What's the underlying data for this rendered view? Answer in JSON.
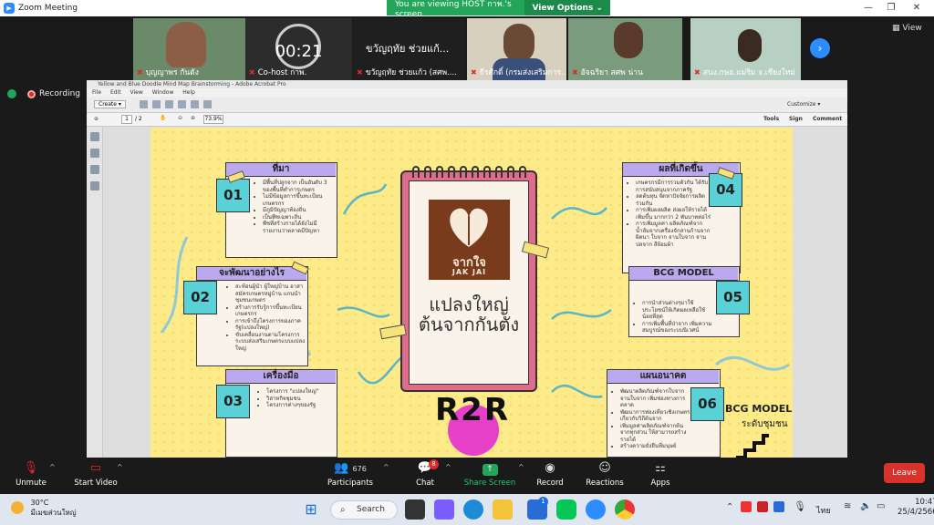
{
  "zoom": {
    "window_title": "Zoom Meeting",
    "banner_text": "You are viewing HOST กาพ.'s screen",
    "view_options_label": "View Options",
    "view_label": "View",
    "recording_label": "Recording",
    "timer": "00:21",
    "participants": [
      {
        "name": "บุญญาพร กันดัง"
      },
      {
        "name": "Co-host กาพ."
      },
      {
        "name": "ขวัญฤทัย ช่วยแก้ว (สศพ...."
      },
      {
        "name": "ธีรศักดิ์ (กรมส่งเสริมการ..."
      },
      {
        "name": "อัจฉริยา สศพ น่าน"
      },
      {
        "name": "สนง.กษอ.แม่ริม จ.เชียงใหม่"
      }
    ],
    "speaker_caption": "ขวัญฤทัย ช่วยแก้...",
    "toolbar": {
      "unmute": "Unmute",
      "start_video": "Start Video",
      "participants": "Participants",
      "participants_count": "676",
      "chat": "Chat",
      "chat_badge": "8",
      "share_screen": "Share Screen",
      "record": "Record",
      "reactions": "Reactions",
      "apps": "Apps",
      "leave": "Leave"
    }
  },
  "acrobat": {
    "title": "Yellow and Blue Doodle Mind Map Brainstorming - Adobe Acrobat Pro",
    "menu": [
      "File",
      "Edit",
      "View",
      "Window",
      "Help"
    ],
    "create_label": "Create",
    "page_num": "1",
    "page_total": "/ 2",
    "zoom": "73.9%",
    "customize": "Customize",
    "tools": "Tools",
    "sign": "Sign",
    "comment": "Comment"
  },
  "mindmap": {
    "center": {
      "brand": "จากใจ",
      "brand_en": "JAK JAI",
      "slogan_line1": "แปลงใหญ่",
      "slogan_line2": "ต้นจากกันตัง"
    },
    "cards": [
      {
        "num": "01",
        "title": "ที่มา",
        "items": [
          "มีพื้นที่ปลูกจาก เป็นอันดับ 3 ของพื้นที่ทำการเกษตร",
          "ไม่มีข้อมูลการขึ้นทะเบียนเกษตรกร",
          "มีภูมิปัญญาท้องถิ่น",
          "เป็นพืชเฉพาะถิ่น",
          "พืชที่สร้างรายได้ยังไม่มีรายงานว่าตลาดมีปัญหา"
        ]
      },
      {
        "num": "02",
        "title": "จะพัฒนาอย่างไร",
        "items": [
          "สะท้อนผู้นำ ผู้ใหญ่บ้าน อาสาสมัครเกษตรหมู่บ้าน แกนนำชุมชนเกษตร",
          "สร้างการรับรู้การขึ้นทะเบียนเกษตรกร",
          "การเข้าถึงโครงการของภาครัฐ(แปลงใหญ่)",
          "ขับเคลื่อนงานตามโครงการระบบส่งเสริมเกษตรแบบแปลงใหญ่"
        ]
      },
      {
        "num": "03",
        "title": "เครื่องมือ",
        "items": [
          "โครงการ \"แปลงใหญ่\"",
          "วิสาหกิจชุมชน",
          "โครงการต่างๆของรัฐ"
        ]
      },
      {
        "num": "04",
        "title": "ผลที่เกิดขึ้น",
        "items": [
          "เกษตรกรมีการรวมตัวกัน ได้รับการสนับสนุนจากภาครัฐ",
          "ลดต้นทุน จัดหาปัจจัยการผลิตร่วมกัน",
          "การเพิ่มผลผลิต ส่งผลให้รายได้เพิ่มขึ้น มากกว่า 2 พันบาทต่อไร่",
          "การเพิ่มมูลค่า ผลิตภัณฑ์จาก น้ำส้มจากเครื่องจักสานก้านจาก ผิดนา ใบจาก จานใบจาก จานปลจาก สีย้อมผ้า"
        ]
      },
      {
        "num": "05",
        "title": "BCG MODEL",
        "items": [
          "การนำส่วนต่างๆมาใช้ประโยชน์ให้เกิดผลเหลือใช้น้อยที่สุด",
          "การเพิ่มพื้นที่ป่าจาก เพิ่มความสมบูรณ์ของระบบนิเวศน์"
        ]
      },
      {
        "num": "06",
        "title": "แผนอนาคต",
        "items": [
          "พัฒนาผลิตภัณฑ์จากใบจาก จานใบจาก เพิ่มช่องทางการตลาด",
          "พัฒนาการท่องเที่ยวเชิงเกษตรเกี่ยวกับวิถีต้นจาก",
          "เพิ่มมูลค่าผลิตภัณฑ์จากต้นจากทุกส่วน ให้สามารถสร้างรายได้",
          "สร้างความยั่งยืนที่มนุษย์"
        ]
      }
    ],
    "r2r": "R2R",
    "bcg_sub_line1": "BCG MODEL",
    "bcg_sub_line2": "ระดับชุมชน"
  },
  "taskbar": {
    "weather_temp": "30°C",
    "weather_desc": "มีเมฆส่วนใหญ่",
    "search": "Search",
    "lang": "ไทย",
    "time": "10:47",
    "date": "25/4/2566",
    "store_badge": "1"
  },
  "colors": {
    "zoom_green": "#23a55a",
    "zoom_blue": "#2d8cff",
    "leave_red": "#d9322a",
    "page_yellow": "#fdeb8a",
    "card_head": "#bba9f0",
    "num_teal": "#5ad1d6",
    "pad_pink": "#e06c8c",
    "logo_brown": "#7a3a1c",
    "r2r_magenta": "#e640c8"
  }
}
